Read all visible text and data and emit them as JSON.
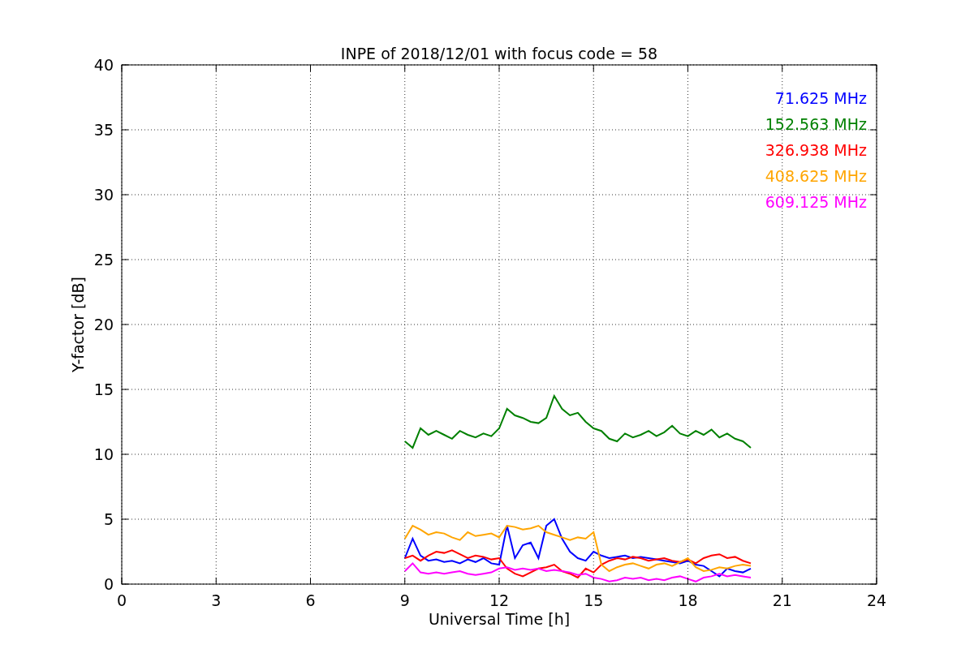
{
  "figure": {
    "chart_data": {
      "type": "line",
      "title": "INPE of 2018/12/01 with focus code = 58",
      "xlabel": "Universal Time [h]",
      "ylabel": "Y-factor [dB]",
      "x": [
        9,
        9.25,
        9.5,
        9.75,
        10,
        10.25,
        10.5,
        10.75,
        11,
        11.25,
        11.5,
        11.75,
        12,
        12.25,
        12.5,
        12.75,
        13,
        13.25,
        13.5,
        13.75,
        14,
        14.25,
        14.5,
        14.75,
        15,
        15.25,
        15.5,
        15.75,
        16,
        16.25,
        16.5,
        16.75,
        17,
        17.25,
        17.5,
        17.75,
        18,
        18.25,
        18.5,
        18.75,
        19,
        19.25,
        19.5,
        19.75,
        20
      ],
      "series": [
        {
          "name": "71.625 MHz",
          "color": "#0000ff",
          "values": [
            2,
            3.5,
            2.2,
            1.8,
            1.9,
            1.7,
            1.8,
            1.6,
            1.9,
            1.7,
            2,
            1.6,
            1.5,
            4.5,
            2,
            3,
            3.2,
            2,
            4.5,
            5,
            3.5,
            2.5,
            2,
            1.8,
            2.5,
            2.2,
            2,
            2.1,
            2.2,
            2,
            2.1,
            2,
            1.9,
            1.8,
            1.7,
            1.6,
            1.8,
            1.5,
            1.4,
            1,
            0.6,
            1.2,
            1,
            0.9,
            1.2
          ]
        },
        {
          "name": "152.563 MHz",
          "color": "#008000",
          "values": [
            11,
            10.5,
            12,
            11.5,
            11.8,
            11.5,
            11.2,
            11.8,
            11.5,
            11.3,
            11.6,
            11.4,
            12,
            13.5,
            13,
            12.8,
            12.5,
            12.4,
            12.8,
            14.5,
            13.5,
            13,
            13.2,
            12.5,
            12,
            11.8,
            11.2,
            11,
            11.6,
            11.3,
            11.5,
            11.8,
            11.4,
            11.7,
            12.2,
            11.6,
            11.4,
            11.8,
            11.5,
            11.9,
            11.3,
            11.6,
            11.2,
            11,
            10.5
          ]
        },
        {
          "name": "326.938 MHz",
          "color": "#ff0000",
          "values": [
            2,
            2.2,
            1.8,
            2.2,
            2.5,
            2.4,
            2.6,
            2.3,
            2,
            2.2,
            2.1,
            1.9,
            2,
            1.2,
            0.8,
            0.6,
            0.9,
            1.2,
            1.3,
            1.5,
            1,
            0.8,
            0.5,
            1.2,
            0.9,
            1.5,
            1.8,
            2,
            1.9,
            2.1,
            2,
            1.8,
            1.9,
            2,
            1.8,
            1.7,
            1.9,
            1.6,
            2,
            2.2,
            2.3,
            2,
            2.1,
            1.8,
            1.6
          ]
        },
        {
          "name": "408.625 MHz",
          "color": "#ffa500",
          "values": [
            3.5,
            4.5,
            4.2,
            3.8,
            4,
            3.9,
            3.6,
            3.4,
            4,
            3.7,
            3.8,
            3.9,
            3.6,
            4.5,
            4.4,
            4.2,
            4.3,
            4.5,
            4,
            3.8,
            3.6,
            3.4,
            3.6,
            3.5,
            4,
            1.5,
            1,
            1.3,
            1.5,
            1.6,
            1.4,
            1.2,
            1.5,
            1.6,
            1.4,
            1.7,
            2,
            1.3,
            1,
            1.1,
            1.3,
            1.2,
            1.4,
            1.5,
            1.4
          ]
        },
        {
          "name": "609.125 MHz",
          "color": "#ff00ff",
          "values": [
            1,
            1.6,
            0.9,
            0.8,
            0.9,
            0.8,
            0.9,
            1,
            0.8,
            0.7,
            0.8,
            0.9,
            1.2,
            1.3,
            1.1,
            1.2,
            1.1,
            1.2,
            1,
            1.1,
            1,
            0.9,
            0.7,
            0.8,
            0.5,
            0.4,
            0.2,
            0.3,
            0.5,
            0.4,
            0.5,
            0.3,
            0.4,
            0.3,
            0.5,
            0.6,
            0.4,
            0.2,
            0.5,
            0.6,
            0.8,
            0.6,
            0.7,
            0.6,
            0.5
          ]
        }
      ],
      "grid": true,
      "xlim": [
        0,
        24
      ],
      "ylim": [
        0,
        40
      ],
      "xticks": [
        0,
        3,
        6,
        9,
        12,
        15,
        18,
        21,
        24
      ],
      "yticks": [
        0,
        5,
        10,
        15,
        20,
        25,
        30,
        35,
        40
      ]
    }
  }
}
